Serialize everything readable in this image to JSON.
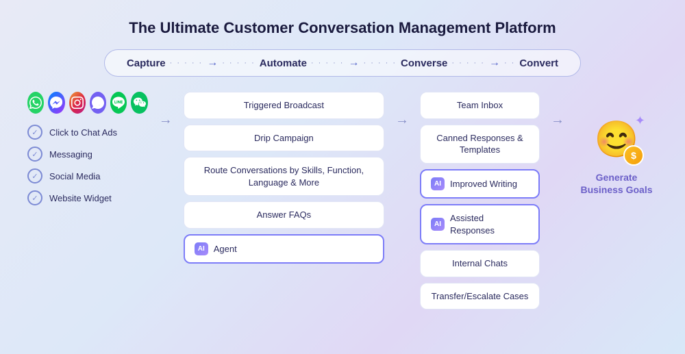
{
  "title": "The Ultimate Customer Conversation Management Platform",
  "pipeline": {
    "steps": [
      {
        "label": "Capture"
      },
      {
        "label": "Automate"
      },
      {
        "label": "Converse"
      },
      {
        "label": "Convert"
      }
    ]
  },
  "left_col": {
    "social_icons": [
      {
        "name": "whatsapp-icon",
        "emoji": "💬",
        "bg": "#25d366"
      },
      {
        "name": "messenger-icon",
        "emoji": "💬",
        "bg": "#0084ff"
      },
      {
        "name": "instagram-icon",
        "emoji": "📷",
        "bg": "#e1306c"
      },
      {
        "name": "viber-icon",
        "emoji": "📞",
        "bg": "#7360f2"
      },
      {
        "name": "line-icon",
        "emoji": "💬",
        "bg": "#06c755"
      },
      {
        "name": "wechat-icon",
        "emoji": "💬",
        "bg": "#07c160"
      }
    ],
    "items": [
      {
        "label": "Click to Chat Ads"
      },
      {
        "label": "Messaging"
      },
      {
        "label": "Social Media"
      },
      {
        "label": "Website Widget"
      }
    ]
  },
  "automate_col": {
    "items": [
      {
        "label": "Triggered Broadcast",
        "ai": false
      },
      {
        "label": "Drip Campaign",
        "ai": false
      },
      {
        "label": "Route Conversations by Skills, Function, Language & More",
        "ai": false
      },
      {
        "label": "Answer FAQs",
        "ai": false
      },
      {
        "label": "Agent",
        "ai": true
      }
    ]
  },
  "converse_col": {
    "items": [
      {
        "label": "Team Inbox",
        "ai": false
      },
      {
        "label": "Canned Responses & Templates",
        "ai": false
      },
      {
        "label": "Improved Writing",
        "ai": true
      },
      {
        "label": "Assisted Responses",
        "ai": true
      },
      {
        "label": "Internal Chats",
        "ai": false
      },
      {
        "label": "Transfer/Escalate Cases",
        "ai": false
      }
    ]
  },
  "right_col": {
    "emoji": "😊",
    "coin_symbol": "$",
    "label": "Generate\nBusiness Goals",
    "sparkle": "✦"
  },
  "ai_badge_text": "AI"
}
